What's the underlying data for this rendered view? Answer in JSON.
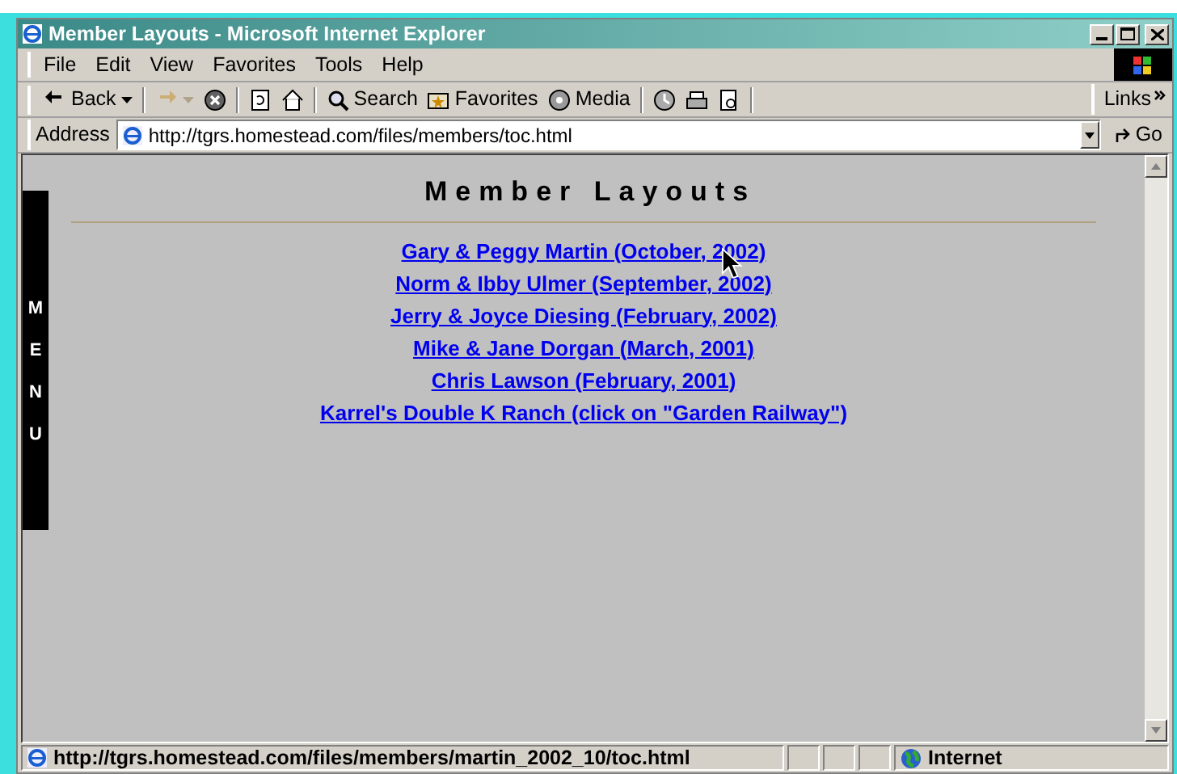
{
  "window": {
    "title": "Member Layouts - Microsoft Internet Explorer"
  },
  "menu_bar": [
    "File",
    "Edit",
    "View",
    "Favorites",
    "Tools",
    "Help"
  ],
  "toolbar": [
    {
      "kind": "back",
      "label": "Back",
      "disabled": false
    },
    {
      "kind": "forward",
      "disabled": true
    },
    {
      "kind": "stop",
      "disabled": false
    },
    {
      "kind": "refresh",
      "disabled": false
    },
    {
      "kind": "home",
      "disabled": false
    },
    {
      "kind": "search",
      "label": "Search",
      "disabled": false
    },
    {
      "kind": "favorites",
      "label": "Favorites",
      "disabled": false
    },
    {
      "kind": "media",
      "label": "Media",
      "disabled": false
    },
    {
      "kind": "history",
      "disabled": false
    },
    {
      "kind": "print",
      "disabled": false
    },
    {
      "kind": "preview",
      "disabled": false
    }
  ],
  "links_label": "Links",
  "address_bar": {
    "label": "Address",
    "value": "http://tgrs.homestead.com/files/members/toc.html",
    "go": "Go"
  },
  "page": {
    "side_menu": "MENU",
    "heading": "Member Layouts",
    "links": [
      "Gary & Peggy Martin (October, 2002)",
      "Norm & Ibby Ulmer (September, 2002)",
      "Jerry & Joyce Diesing (February, 2002)",
      "Mike & Jane Dorgan (March, 2001)",
      "Chris Lawson (February, 2001)",
      "Karrel's Double K Ranch (click on \"Garden Railway\")"
    ]
  },
  "status_bar": {
    "text": "http://tgrs.homestead.com/files/members/martin_2002_10/toc.html",
    "zone": "Internet"
  }
}
